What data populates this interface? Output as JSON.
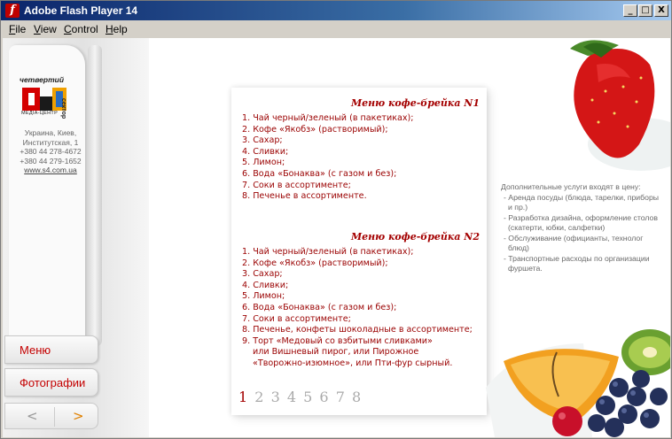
{
  "window": {
    "title": "Adobe Flash Player 14"
  },
  "menubar": {
    "items": [
      "File",
      "View",
      "Control",
      "Help"
    ]
  },
  "window_controls": {
    "minimize": "_",
    "maximize": "□",
    "close": "X"
  },
  "sidebar": {
    "logo_text_top": "четвертий",
    "logo_text_side": "сектор",
    "logo_text_bottom": "МЕДІА-ЦЕНТР",
    "contact": [
      "Украина, Киев,",
      "Институтская, 1",
      "+380 44 278-4672",
      "+380 44 279-1652"
    ],
    "site": "www.s4.com.ua",
    "buttons": {
      "menu": "Меню",
      "photos": "Фотографии"
    },
    "nav": {
      "prev": "<",
      "next": ">"
    }
  },
  "content": {
    "menu1": {
      "title": "Меню кофе-брейка N1",
      "items": [
        "1. Чай черный/зеленый (в пакетиках);",
        "2. Кофе «Якобз» (растворимый);",
        "3. Сахар;",
        "4. Сливки;",
        "5. Лимон;",
        "6. Вода «Бонаква» (с газом и без);",
        "7. Соки в ассортименте;",
        "8. Печенье в ассортименте."
      ]
    },
    "menu2": {
      "title": "Меню кофе-брейка N2",
      "items": [
        "1. Чай черный/зеленый (в пакетиках);",
        "2. Кофе «Якобз» (растворимый);",
        "3. Сахар;",
        "4. Сливки;",
        "5. Лимон;",
        "6. Вода «Бонаква» (с газом и без);",
        "7. Соки в ассортименте;",
        "8. Печенье, конфеты шоколадные  в ассортименте;",
        "9. Торт «Медовый со взбитыми сливками»",
        "    или Вишневый пирог, или Пирожное",
        "    «Творожно-изюмное», или Пти-фур сырный."
      ]
    },
    "pages": [
      "1",
      "2",
      "3",
      "4",
      "5",
      "6",
      "7",
      "8"
    ],
    "active_page": "1"
  },
  "extras": {
    "heading": "Дополнительные услуги входят в цену:",
    "items": [
      "- Аренда посуды (блюда, тарелки, приборы и пр.)",
      "- Разработка дизайна, оформление столов (скатерти, юбки, салфетки)",
      "- Обслуживание (официанты, технолог блюд)",
      "- Транспортные расходы по организации фуршета."
    ]
  },
  "colors": {
    "accent": "#a40000",
    "title_bar": "#0a246a"
  }
}
